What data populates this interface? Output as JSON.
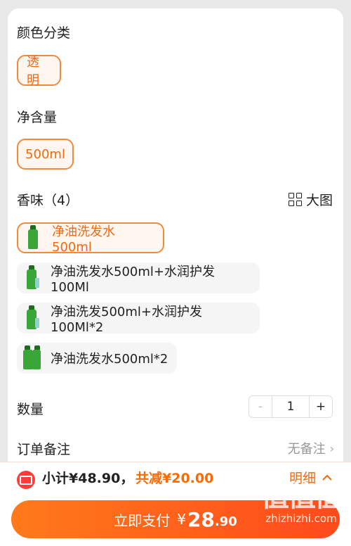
{
  "color_section": {
    "title": "颜色分类",
    "option": "透明"
  },
  "volume_section": {
    "title": "净含量",
    "option": "500ml"
  },
  "scent_section": {
    "title": "香味（4）",
    "big_view_label": "大图",
    "options": [
      {
        "label": "净油洗发水500ml",
        "selected": true,
        "thumb": "single-bottle"
      },
      {
        "label": "净油洗发水500ml+水润护发100Ml",
        "selected": false,
        "thumb": "bottle-with-small"
      },
      {
        "label": "净油洗发500ml+水润护发100Ml*2",
        "selected": false,
        "thumb": "bottle-with-small"
      },
      {
        "label": "净油洗发水500ml*2",
        "selected": false,
        "thumb": "double-bottle"
      }
    ]
  },
  "quantity": {
    "label": "数量",
    "minus": "-",
    "value": "1",
    "plus": "+"
  },
  "order_note": {
    "label": "订单备注",
    "value": "无备注",
    "chevron": "›"
  },
  "footer": {
    "subtotal": "小计¥48.90，",
    "discount": "共减¥20.00",
    "detail_label": "明细",
    "pay_label": "立即支付",
    "pay_currency": "¥",
    "pay_integer": "28",
    "pay_decimal": ".90"
  },
  "watermark": {
    "text": "值值值",
    "sub": "zhizhizhi.com"
  },
  "colors": {
    "accent": "#ef6a10",
    "selected_border": "#f08a3c",
    "pay_gradient_start": "#ff7a1a",
    "pay_gradient_end": "#ff4a1c",
    "coupon_red": "#ff3b3b"
  },
  "icons": {
    "big_view": "grid-icon",
    "coupon": "coupon-icon",
    "detail": "chevron-up-icon",
    "note": "chevron-right-icon"
  }
}
